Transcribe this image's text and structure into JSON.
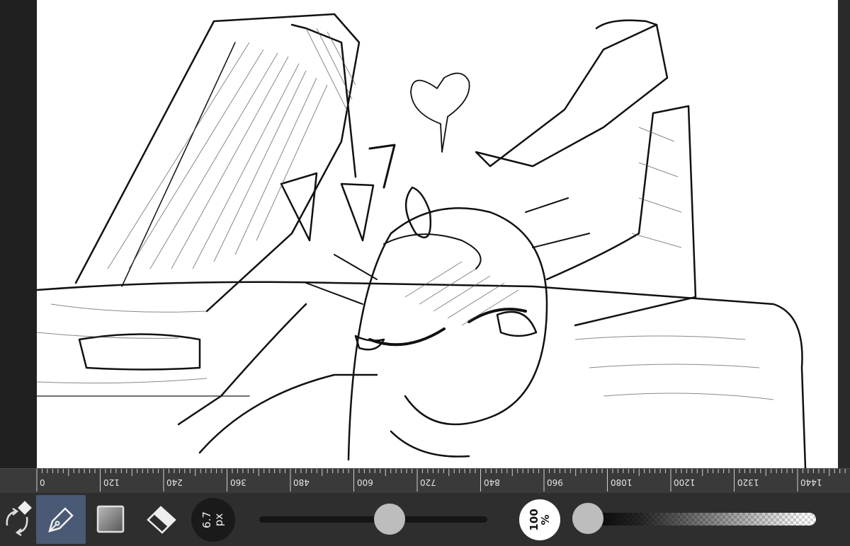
{
  "ruler": {
    "labels": [
      "0",
      "120",
      "240",
      "360",
      "480",
      "600",
      "720",
      "840",
      "960",
      "1080",
      "1200",
      "1320",
      "1440"
    ]
  },
  "toolbar": {
    "brush_size_value": "6.7",
    "brush_size_unit": "px",
    "brush_size_slider_fraction": 0.57,
    "opacity_value": "100",
    "opacity_unit": "%",
    "opacity_slider_fraction": 0.0,
    "tools": [
      {
        "name": "transform-rotate-tool",
        "icon": "rotate-arrows-icon"
      },
      {
        "name": "pen-tool",
        "icon": "pen-nib-icon",
        "active": true
      },
      {
        "name": "fill-tool",
        "icon": "square-gradient-icon"
      },
      {
        "name": "eraser-tool",
        "icon": "eraser-icon"
      }
    ]
  },
  "colors": {
    "accent_active": "#4a5a75",
    "toolbar_bg": "#2e2e2e",
    "canvas_bg": "#ffffff"
  }
}
